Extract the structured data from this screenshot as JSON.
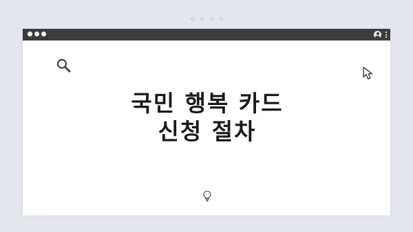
{
  "slide": {
    "title_line1": "국민 행복 카드",
    "title_line2": "신청 절차"
  },
  "icons": {
    "top_indicator": "pagination-dots",
    "window_controls": "three-dots",
    "user": "user-icon",
    "menu": "vertical-dots-icon",
    "search": "magnifier-icon",
    "cursor": "mouse-pointer-icon",
    "bulb": "lightbulb-icon"
  },
  "colors": {
    "background": "#e3e6ec",
    "titlebar": "#3c3c3c",
    "window": "#ffffff",
    "text": "#1a1a1a"
  }
}
